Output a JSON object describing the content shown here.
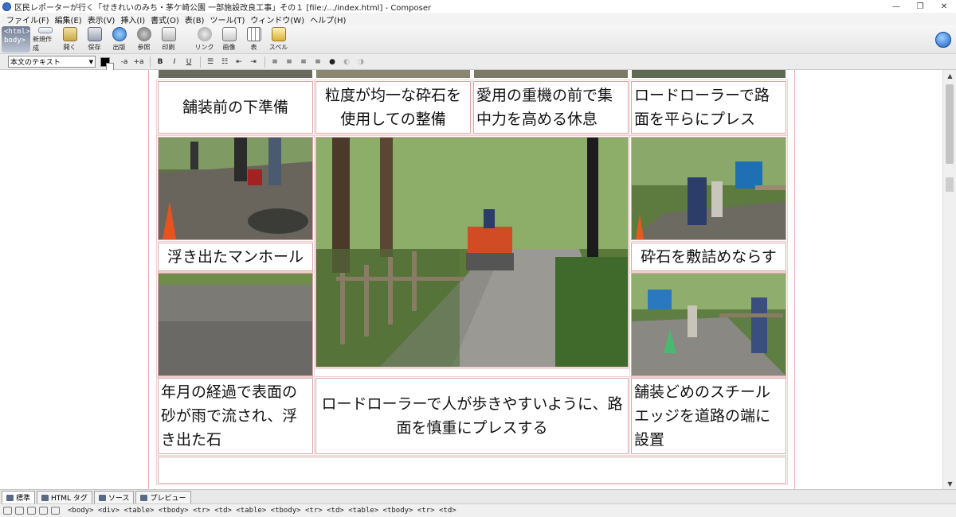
{
  "window": {
    "title": "区民レポーターが行く「せきれいのみち・茅ケ崎公園 一部施設改良工事」その１ [file:/.../index.html] - Composer",
    "controls": [
      "—",
      "❐",
      "✕"
    ]
  },
  "menu": [
    "ファイル(F)",
    "編集(E)",
    "表示(V)",
    "挿入(I)",
    "書式(O)",
    "表(B)",
    "ツール(T)",
    "ウィンドウ(W)",
    "ヘルプ(H)"
  ],
  "toolbar": {
    "badge_line1": "<html>",
    "badge_line2": "body>",
    "buttons": [
      {
        "label": "新規作成",
        "icon": "new-document-icon"
      },
      {
        "label": "開く",
        "icon": "open-folder-icon"
      },
      {
        "label": "保存",
        "icon": "save-icon"
      },
      {
        "label": "出版",
        "icon": "publish-icon"
      },
      {
        "label": "参照",
        "icon": "browse-icon"
      },
      {
        "label": "印刷",
        "icon": "print-icon"
      },
      {
        "label": "リンク",
        "icon": "link-icon"
      },
      {
        "label": "画像",
        "icon": "image-icon"
      },
      {
        "label": "表",
        "icon": "table-icon"
      },
      {
        "label": "スペル",
        "icon": "spell-check-icon"
      }
    ]
  },
  "formatbar": {
    "style_value": "本文のテキスト",
    "buttons": [
      "-a",
      "+a",
      "B",
      "I",
      "U",
      "☰",
      "☷",
      "⇤",
      "⇥",
      "≡",
      "≡",
      "≡",
      "≡"
    ]
  },
  "captions": {
    "c1": "舗装前の下準備",
    "c2": "粒度が均一な砕石を使用しての整備",
    "c3": "愛用の重機の前で集中力を高める休息",
    "c4": "ロードローラーで路面を平らにプレス",
    "c5": "浮き出たマンホール",
    "c6": "砕石を敷詰めならす",
    "c7": "年月の経過で表面の砂が雨で流され、浮き出た石",
    "c8": "ロードローラーで人が歩きやすいように、路面を慎重にプレスする",
    "c9": "舗装どめのスチールエッジを道路の端に設置"
  },
  "modetabs": [
    {
      "label": "標準",
      "icon": "pencil-icon",
      "active": true
    },
    {
      "label": "HTML タグ",
      "icon": "tag-icon",
      "active": false
    },
    {
      "label": "ソース",
      "icon": "source-icon",
      "active": false
    },
    {
      "label": "プレビュー",
      "icon": "preview-icon",
      "active": false
    }
  ],
  "statusbar": {
    "tagpath": "<body> <div> <table> <tbody> <tr> <td> <table> <tbody> <tr> <td> <table> <tbody> <tr> <td>"
  }
}
